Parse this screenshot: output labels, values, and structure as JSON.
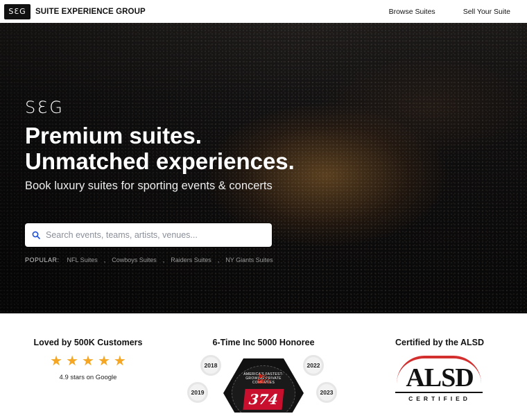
{
  "header": {
    "logo_mark": "SƐG",
    "brand_name": "SUITE EXPERIENCE GROUP",
    "nav": [
      {
        "label": "Browse Suites"
      },
      {
        "label": "Sell Your Suite"
      }
    ]
  },
  "hero": {
    "logo_mark": "SƐG",
    "title_line1": "Premium suites.",
    "title_line2": "Unmatched experiences.",
    "subtitle": "Book luxury suites for sporting events & concerts",
    "search_placeholder": "Search events, teams, artists, venues...",
    "popular_label": "POPULAR:",
    "popular_links": [
      "NFL Suites",
      "Cowboys Suites",
      "Raiders Suites",
      "NY Giants Suites"
    ]
  },
  "trust": {
    "reviews": {
      "heading": "Loved by 500K Customers",
      "stars": 5,
      "rating_text": "4.9 stars on Google"
    },
    "inc": {
      "heading": "6-Time Inc 5000 Honoree",
      "years": [
        "2018",
        "2019",
        "2022",
        "2023"
      ],
      "badge_logo": "Inc. 5000",
      "badge_number": "374",
      "badge_arc_text": "AMERICA'S FASTEST-GROWING PRIVATE COMPANIES"
    },
    "alsd": {
      "heading": "Certified by the ALSD",
      "logo_text": "ALSD",
      "logo_sub": "CERTIFIED"
    }
  },
  "colors": {
    "star": "#f5a623",
    "inc_red": "#c8102e",
    "alsd_red": "#d32f2f"
  }
}
